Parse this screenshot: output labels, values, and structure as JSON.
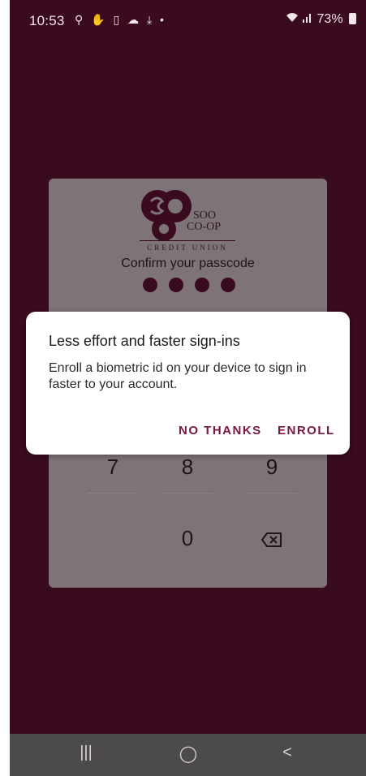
{
  "status_bar": {
    "time": "10:53",
    "left_icons": "⚲ ✋ ▯ ☁ ⤓ •",
    "signal_text": "73%"
  },
  "card": {
    "logo": {
      "line1": "SOO",
      "line2": "CO-OP",
      "subtitle": "CREDIT UNION"
    },
    "prompt": "Confirm your passcode",
    "dots_filled": 4,
    "keys": {
      "seven": "7",
      "eight": "8",
      "nine": "9",
      "zero": "0"
    }
  },
  "dialog": {
    "title": "Less effort and faster sign-ins",
    "body": "Enroll a biometric id on your device to sign in faster to your account.",
    "no_thanks": "NO THANKS",
    "enroll": "ENROLL"
  },
  "colors": {
    "background": "#3a0a1e",
    "accent": "#7a1642",
    "card": "#7e7478"
  },
  "navbar": {
    "recent": "|||",
    "home": "◯",
    "back": "<"
  }
}
